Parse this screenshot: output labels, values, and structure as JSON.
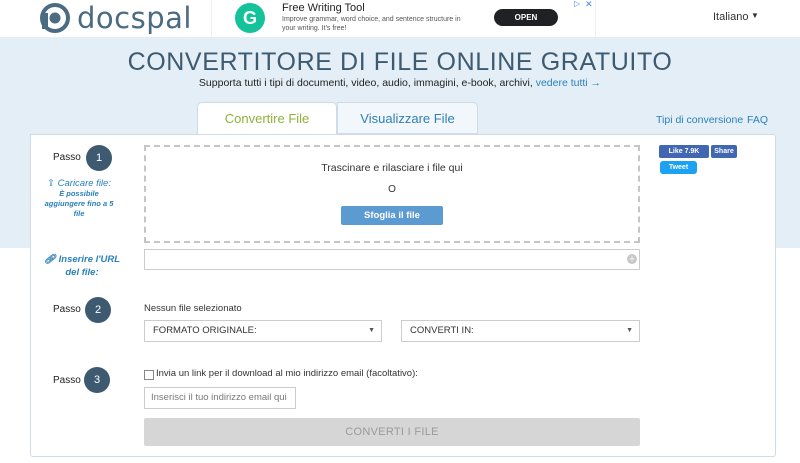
{
  "header": {
    "logo_text": "docspal",
    "language": "Italiano",
    "ad": {
      "icon_letter": "G",
      "title": "Free Writing Tool",
      "description": "Improve grammar, word choice, and sentence structure in your writing. It's free!",
      "button": "OPEN"
    }
  },
  "hero": {
    "title": "CONVERTITORE DI FILE ONLINE GRATUITO",
    "subtitle": "Supporta tutti i tipi di documenti, video, audio, immagini, e-book, archivi,",
    "subtitle_link": "vedere tutti →"
  },
  "tabs": [
    {
      "label": "Convertire File"
    },
    {
      "label": "Visualizzare File"
    }
  ],
  "links": {
    "conversion_types": "Tipi di conversione",
    "faq": "FAQ"
  },
  "social": {
    "like": "Like 7.9K",
    "share": "Share",
    "tweet": "Tweet"
  },
  "step1": {
    "label": "Passo",
    "number": "1",
    "upload_link": "Caricare file:",
    "upload_note": "È possibile aggiungere fino a 5 file",
    "drop_text": "Trascinare e rilasciare i file qui",
    "or_text": "O",
    "browse_button": "Sfoglia il file",
    "url_label": "Inserire l'URL del file:"
  },
  "step2": {
    "label": "Passo",
    "number": "2",
    "no_file": "Nessun file selezionato",
    "source_format": "FORMATO ORIGINALE:",
    "target_format": "CONVERTI IN:"
  },
  "step3": {
    "label": "Passo",
    "number": "3",
    "email_checkbox_label": "Invia un link per il download al mio indirizzo email (facoltativo):",
    "email_placeholder": "Inserisci il tuo indirizzo email qui",
    "convert_button": "CONVERTI I FILE"
  },
  "colors": {
    "brand": "#3d5a70",
    "accent_blue": "#2a80b9",
    "active_tab": "#8fb23a",
    "band": "#e3eef6"
  }
}
